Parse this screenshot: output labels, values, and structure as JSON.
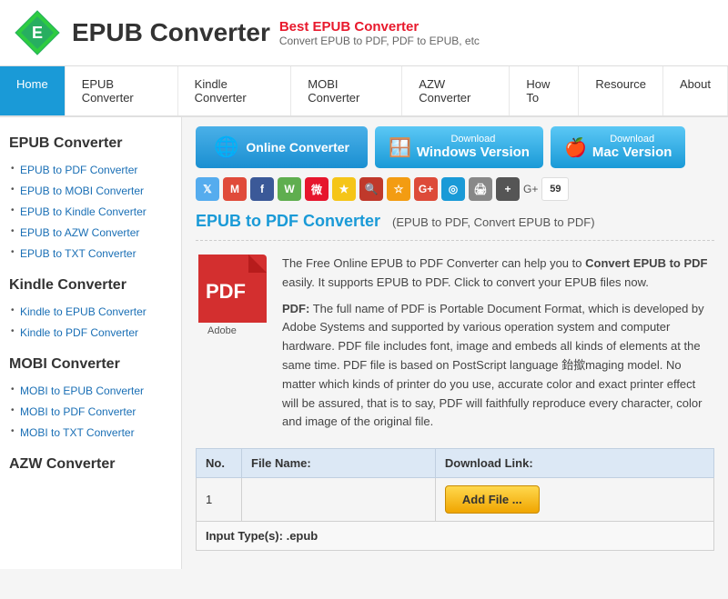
{
  "header": {
    "logo_text": "EPUB Converter",
    "tagline_title": "Best EPUB Converter",
    "tagline_sub": "Convert EPUB to PDF, PDF to EPUB, etc"
  },
  "nav": {
    "items": [
      {
        "label": "Home",
        "active": true
      },
      {
        "label": "EPUB Converter",
        "active": false
      },
      {
        "label": "Kindle Converter",
        "active": false
      },
      {
        "label": "MOBI Converter",
        "active": false
      },
      {
        "label": "AZW Converter",
        "active": false
      },
      {
        "label": "How To",
        "active": false
      },
      {
        "label": "Resource",
        "active": false
      },
      {
        "label": "About",
        "active": false
      }
    ]
  },
  "sidebar": {
    "sections": [
      {
        "title": "EPUB Converter",
        "links": [
          "EPUB to PDF Converter",
          "EPUB to MOBI Converter",
          "EPUB to Kindle Converter",
          "EPUB to AZW Converter",
          "EPUB to TXT Converter"
        ]
      },
      {
        "title": "Kindle Converter",
        "links": [
          "Kindle to EPUB Converter",
          "Kindle to PDF Converter"
        ]
      },
      {
        "title": "MOBI Converter",
        "links": [
          "MOBI to EPUB Converter",
          "MOBI to PDF Converter",
          "MOBI to TXT Converter"
        ]
      },
      {
        "title": "AZW Converter",
        "links": []
      }
    ]
  },
  "actions": {
    "online_btn": "Online Converter",
    "windows_btn_top": "Download",
    "windows_btn_bottom": "Windows Version",
    "mac_btn_top": "Download",
    "mac_btn_bottom": "Mac Version"
  },
  "page": {
    "title": "EPUB to PDF Converter",
    "title_sub": "(EPUB to PDF, Convert EPUB to PDF)",
    "description1": "The Free Online EPUB to PDF Converter can help you to ",
    "description1_bold": "Convert EPUB to PDF",
    "description1_rest": " easily. It supports EPUB to PDF. Click to convert your EPUB files now.",
    "description2_bold": "PDF:",
    "description2": " The full name of PDF is Portable Document Format, which is developed by Adobe Systems and supported by various operation system and computer hardware. PDF file includes font, image and embeds all kinds of elements at the same time. PDF file is based on PostScript language 鈶撳maging model. No matter which kinds of printer do you use, accurate color and exact printer effect will be assured, that is to say, PDF will faithfully reproduce every character, color and image of the original file."
  },
  "table": {
    "col_no": "No.",
    "col_filename": "File Name:",
    "col_download": "Download Link:",
    "rows": [
      {
        "no": "1",
        "filename": "",
        "download": "Add File ..."
      }
    ],
    "input_types_label": "Input Type(s): .epub"
  },
  "social": {
    "gplus_count": "59"
  }
}
